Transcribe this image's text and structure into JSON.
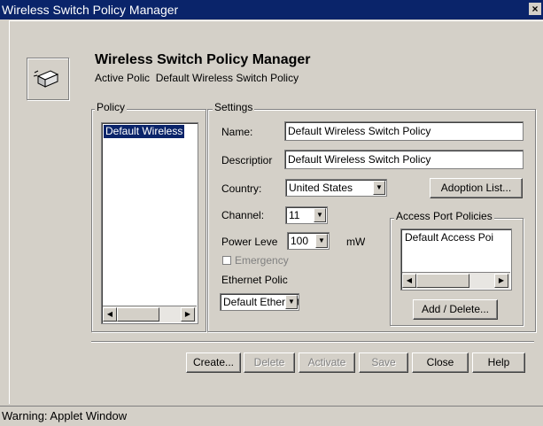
{
  "window": {
    "title": "Wireless Switch Policy Manager",
    "close_label": "×"
  },
  "header": {
    "title": "Wireless Switch Policy Manager",
    "active_label": "Active Polic",
    "active_value": "Default Wireless Switch Policy"
  },
  "policy": {
    "legend": "Policy",
    "items": [
      "Default Wireless"
    ]
  },
  "settings": {
    "legend": "Settings",
    "name_label": "Name:",
    "name_value": "Default Wireless Switch Policy",
    "description_label": "Descriptior",
    "description_value": "Default Wireless Switch Policy",
    "country_label": "Country:",
    "country_value": "United States",
    "adoption_button": "Adoption List...",
    "channel_label": "Channel:",
    "channel_value": "11",
    "power_label": "Power Leve",
    "power_value": "100",
    "power_unit": "mW",
    "emergency_label": "Emergency",
    "ethernet_label": "Ethernet Polic",
    "ethernet_value": "Default Ethernet"
  },
  "access_port": {
    "legend": "Access Port Policies",
    "items": [
      "Default Access Poi"
    ],
    "add_delete_button": "Add / Delete..."
  },
  "buttons": {
    "create": "Create...",
    "delete": "Delete",
    "activate": "Activate",
    "save": "Save",
    "close": "Close",
    "help": "Help"
  },
  "status_bar": "Warning: Applet Window"
}
